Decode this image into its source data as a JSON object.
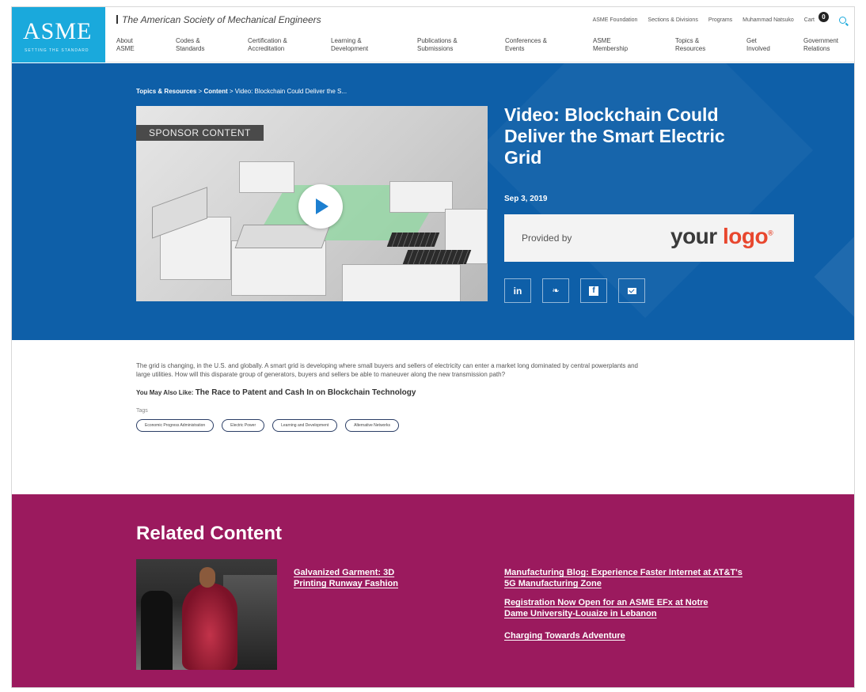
{
  "header": {
    "logo": "ASME",
    "logo_tagline": "SETTING THE STANDARD",
    "org_name": "The American Society of Mechanical Engineers",
    "utility_links": [
      "ASME Foundation",
      "Sections & Divisions",
      "Programs",
      "Muhammad Natsuko",
      "Cart"
    ],
    "cart_count": "0",
    "nav": [
      {
        "line1": "About",
        "line2": "ASME"
      },
      {
        "line1": "Codes &",
        "line2": "Standards"
      },
      {
        "line1": "Certification &",
        "line2": "Accreditation"
      },
      {
        "line1": "Learning &",
        "line2": "Development"
      },
      {
        "line1": "Publications &",
        "line2": "Submissions"
      },
      {
        "line1": "Conferences &",
        "line2": "Events"
      },
      {
        "line1": "ASME",
        "line2": "Membership"
      },
      {
        "line1": "Topics &",
        "line2": "Resources"
      },
      {
        "line1": "Get",
        "line2": "Involved"
      },
      {
        "line1": "Government",
        "line2": "Relations"
      }
    ]
  },
  "hero": {
    "breadcrumb": {
      "part1": "Topics & Resources",
      "sep1": " > ",
      "part2": "Content",
      "sep2": " > ",
      "current": "Video: Blockchain Could Deliver the S..."
    },
    "sponsor_label": "SPONSOR CONTENT",
    "title": "Video: Blockchain Could Deliver the Smart Electric Grid",
    "date": "Sep 3, 2019",
    "provided_label": "Provided by",
    "provider_logo": {
      "part1": "your ",
      "part2": "logo",
      "mark": "®"
    },
    "socials": [
      {
        "icon": "linkedin-icon",
        "glyph": "in"
      },
      {
        "icon": "twitter-icon",
        "glyph": "❧"
      },
      {
        "icon": "facebook-icon",
        "glyph": "f"
      },
      {
        "icon": "email-icon",
        "glyph": ""
      }
    ]
  },
  "body": {
    "paragraph": "The grid is changing, in the U.S. and globally. A smart grid is developing where small buyers and sellers of electricity can enter a market long dominated by central powerplants and large utilities. How will this disparate group of generators, buyers and sellers be able to maneuver along the new transmission path?",
    "also_label": "You May Also Like: ",
    "also_link": "The Race to Patent and Cash In on Blockchain Technology",
    "tags_label": "Tags",
    "tags": [
      "Economic Progress Administration",
      "Electric Power",
      "Learning and Development",
      "Alternative Networks"
    ]
  },
  "related": {
    "title": "Related Content",
    "featured_link": "Galvanized Garment: 3D Printing Runway Fashion",
    "links": [
      "Manufacturing Blog: Experience Faster Internet at AT&T's 5G Manufacturing Zone",
      "Registration Now Open for an ASME EFx at Notre Dame University-Louaize in Lebanon",
      "Charging Towards Adventure"
    ]
  },
  "colors": {
    "logo_bg": "#1aa9dc",
    "hero_bg": "#0e5fa8",
    "related_bg": "#9b1a5e",
    "logo_accent": "#e8472e"
  }
}
